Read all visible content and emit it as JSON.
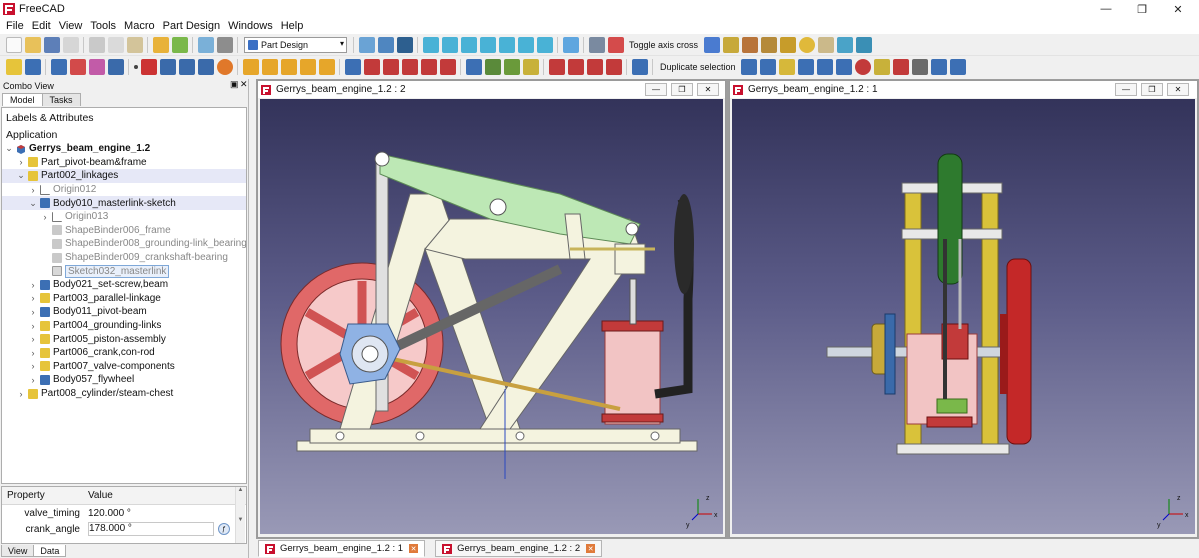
{
  "window": {
    "title": "FreeCAD",
    "minimize_glyph": "—",
    "maximize_glyph": "❐",
    "close_glyph": "✕"
  },
  "menu": [
    "File",
    "Edit",
    "View",
    "Tools",
    "Macro",
    "Part Design",
    "Windows",
    "Help"
  ],
  "toolbar": {
    "workbench_selected": "Part Design",
    "toggle_axis_cross_label": "Toggle axis cross",
    "duplicate_selection_label": "Duplicate selection"
  },
  "combo_view": {
    "title": "Combo View",
    "tabs": [
      "Model",
      "Tasks"
    ],
    "heading": "Labels & Attributes",
    "section": "Application",
    "tree": [
      {
        "label": "Gerrys_beam_engine_1.2",
        "icon": "document-icon"
      },
      {
        "label": "Part_pivot-beam&frame",
        "icon": "part-icon"
      },
      {
        "label": "Part002_linkages",
        "icon": "part-icon"
      },
      {
        "label": "Origin012",
        "icon": "origin-icon"
      },
      {
        "label": "Body010_masterlink-sketch",
        "icon": "body-icon"
      },
      {
        "label": "Origin013",
        "icon": "origin-icon"
      },
      {
        "label": "ShapeBinder006_frame",
        "icon": "shapebinder-icon"
      },
      {
        "label": "ShapeBinder008_grounding-link_bearing",
        "icon": "shapebinder-icon"
      },
      {
        "label": "ShapeBinder009_crankshaft-bearing",
        "icon": "shapebinder-icon"
      },
      {
        "label": "Sketch032_masterlink",
        "icon": "sketch-icon"
      },
      {
        "label": "Body021_set-screw,beam",
        "icon": "body-icon"
      },
      {
        "label": "Part003_parallel-linkage",
        "icon": "part-icon"
      },
      {
        "label": "Body011_pivot-beam",
        "icon": "body-icon"
      },
      {
        "label": "Part004_grounding-links",
        "icon": "part-icon"
      },
      {
        "label": "Part005_piston-assembly",
        "icon": "part-icon"
      },
      {
        "label": "Part006_crank,con-rod",
        "icon": "part-icon"
      },
      {
        "label": "Part007_valve-components",
        "icon": "part-icon"
      },
      {
        "label": "Body057_flywheel",
        "icon": "body-icon"
      },
      {
        "label": "Part008_cylinder/steam-chest",
        "icon": "part-icon"
      }
    ],
    "properties": {
      "header_property": "Property",
      "header_value": "Value",
      "rows": [
        {
          "name": "valve_timing",
          "value": "120.000 °"
        },
        {
          "name": "crank_angle",
          "value": "178.000 °"
        }
      ]
    },
    "bottom_tabs": [
      "View",
      "Data"
    ]
  },
  "views": [
    {
      "title": "Gerrys_beam_engine_1.2 : 2"
    },
    {
      "title": "Gerrys_beam_engine_1.2 : 1"
    }
  ],
  "doc_tabs": [
    {
      "label": "Gerrys_beam_engine_1.2 : 1"
    },
    {
      "label": "Gerrys_beam_engine_1.2 : 2"
    }
  ],
  "axis_labels": {
    "x": "x",
    "y": "y",
    "z": "z"
  }
}
